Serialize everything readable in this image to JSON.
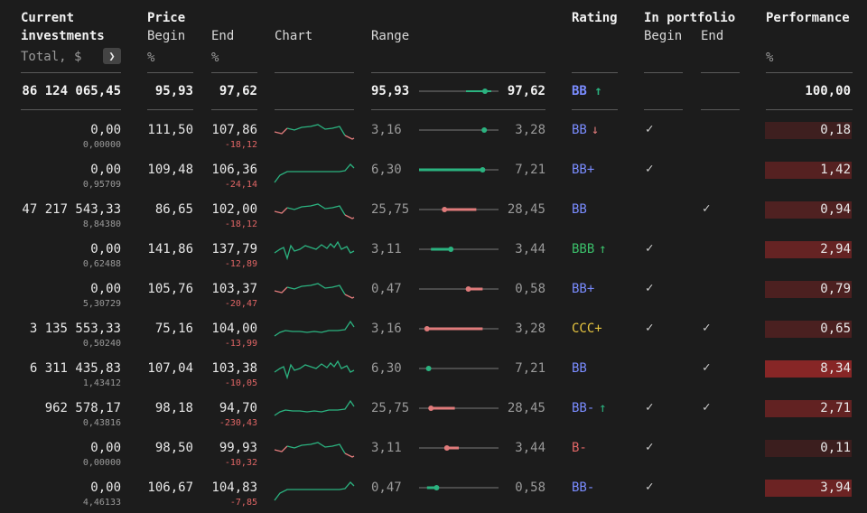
{
  "headers": {
    "current_line1": "Current",
    "current_line2": "investments",
    "current_line3": "Total, $",
    "price": "Price",
    "begin": "Begin",
    "end": "End",
    "pct1": "%",
    "pct2": "%",
    "chart": "Chart",
    "range": "Range",
    "rating": "Rating",
    "portfolio": "In portfolio",
    "pbegin": "Begin",
    "pend": "End",
    "performance": "Performance",
    "perf_pct": "%"
  },
  "totals": {
    "total": "86 124 065,45",
    "begin": "95,93",
    "end": "97,62",
    "range_min": "95,93",
    "range_max": "97,62",
    "range_pos": 0.83,
    "rating": "BB",
    "rating_arrow": "↑",
    "performance": "100,00"
  },
  "colors": {
    "green": "#2bb380",
    "red": "#e07b7b",
    "blue": "#7a8cff",
    "bbb_green": "#3bbf6a",
    "yellow": "#e8c640",
    "red_text": "#e06565"
  },
  "rows": [
    {
      "total": "0,00",
      "share": "0,00000",
      "begin": "111,50",
      "end": "107,86",
      "chg": "-18,12",
      "spark": "A",
      "rmin": "3,16",
      "rmax": "3,28",
      "bar": [
        0.82,
        0.82
      ],
      "pos": 0.82,
      "color": "green",
      "rating": "BB",
      "rating_color": "blue",
      "arrow": "↓",
      "arrow_color": "red",
      "pb": true,
      "pe": false,
      "perf": "0,18",
      "perf_share": 0.18
    },
    {
      "total": "0,00",
      "share": "0,95709",
      "begin": "109,48",
      "end": "106,36",
      "chg": "-24,14",
      "spark": "B",
      "rmin": "6,30",
      "rmax": "7,21",
      "bar": [
        0.0,
        0.8
      ],
      "pos": 0.8,
      "color": "green",
      "rating": "BB+",
      "rating_color": "blue",
      "arrow": "",
      "arrow_color": "",
      "pb": true,
      "pe": false,
      "perf": "1,42",
      "perf_share": 1.42
    },
    {
      "total": "47 217 543,33",
      "share": "8,84380",
      "begin": "86,65",
      "end": "102,00",
      "chg": "-18,12",
      "spark": "A",
      "rmin": "25,75",
      "rmax": "28,45",
      "bar": [
        0.32,
        0.72
      ],
      "pos": 0.32,
      "color": "red",
      "rating": "BB",
      "rating_color": "blue",
      "arrow": "",
      "arrow_color": "",
      "pb": false,
      "pe": true,
      "perf": "0,94",
      "perf_share": 0.94
    },
    {
      "total": "0,00",
      "share": "0,62488",
      "begin": "141,86",
      "end": "137,79",
      "chg": "-12,89",
      "spark": "C",
      "rmin": "3,11",
      "rmax": "3,44",
      "bar": [
        0.15,
        0.4
      ],
      "pos": 0.4,
      "color": "green",
      "rating": "BBB",
      "rating_color": "bbb_green",
      "arrow": "↑",
      "arrow_color": "bbb_green",
      "pb": true,
      "pe": false,
      "perf": "2,94",
      "perf_share": 2.94
    },
    {
      "total": "0,00",
      "share": "5,30729",
      "begin": "105,76",
      "end": "103,37",
      "chg": "-20,47",
      "spark": "A",
      "rmin": "0,47",
      "rmax": "0,58",
      "bar": [
        0.6,
        0.8
      ],
      "pos": 0.62,
      "color": "red",
      "rating": "BB+",
      "rating_color": "blue",
      "arrow": "",
      "arrow_color": "",
      "pb": true,
      "pe": false,
      "perf": "0,79",
      "perf_share": 0.79
    },
    {
      "total": "3 135 553,33",
      "share": "0,50240",
      "begin": "75,16",
      "end": "104,00",
      "chg": "-13,99",
      "spark": "D",
      "rmin": "3,16",
      "rmax": "3,28",
      "bar": [
        0.1,
        0.8
      ],
      "pos": 0.1,
      "color": "red",
      "rating": "CCC+",
      "rating_color": "yellow",
      "arrow": "",
      "arrow_color": "",
      "pb": true,
      "pe": true,
      "perf": "0,65",
      "perf_share": 0.65
    },
    {
      "total": "6 311 435,83",
      "share": "1,43412",
      "begin": "107,04",
      "end": "103,38",
      "chg": "-10,05",
      "spark": "C",
      "rmin": "6,30",
      "rmax": "7,21",
      "bar": [
        0.12,
        0.12
      ],
      "pos": 0.12,
      "color": "green",
      "rating": "BB",
      "rating_color": "blue",
      "arrow": "",
      "arrow_color": "",
      "pb": false,
      "pe": true,
      "perf": "8,34",
      "perf_share": 8.34
    },
    {
      "total": "962 578,17",
      "share": "0,43816",
      "begin": "98,18",
      "end": "94,70",
      "chg": "-230,43",
      "spark": "D",
      "rmin": "25,75",
      "rmax": "28,45",
      "bar": [
        0.15,
        0.45
      ],
      "pos": 0.15,
      "color": "red",
      "rating": "BB-",
      "rating_color": "blue",
      "arrow": "↑",
      "arrow_color": "green",
      "pb": true,
      "pe": true,
      "perf": "2,71",
      "perf_share": 2.71
    },
    {
      "total": "0,00",
      "share": "0,00000",
      "begin": "98,50",
      "end": "99,93",
      "chg": "-10,32",
      "spark": "A",
      "rmin": "3,11",
      "rmax": "3,44",
      "bar": [
        0.35,
        0.5
      ],
      "pos": 0.35,
      "color": "red",
      "rating": "B-",
      "rating_color": "red_text",
      "arrow": "",
      "arrow_color": "",
      "pb": true,
      "pe": false,
      "perf": "0,11",
      "perf_share": 0.11
    },
    {
      "total": "0,00",
      "share": "4,46133",
      "begin": "106,67",
      "end": "104,83",
      "chg": "-7,85",
      "spark": "B",
      "rmin": "0,47",
      "rmax": "0,58",
      "bar": [
        0.1,
        0.22
      ],
      "pos": 0.22,
      "color": "green",
      "rating": "BB-",
      "rating_color": "blue",
      "arrow": "",
      "arrow_color": "",
      "pb": true,
      "pe": false,
      "perf": "3,94",
      "perf_share": 3.94
    }
  ]
}
